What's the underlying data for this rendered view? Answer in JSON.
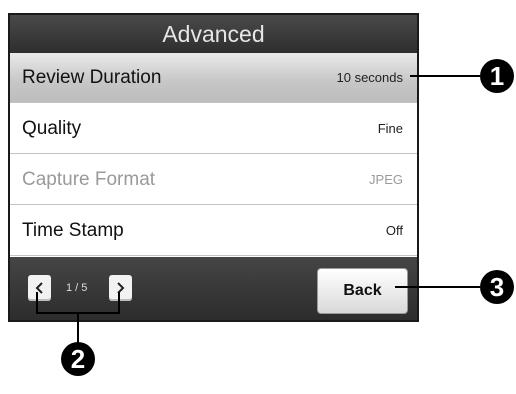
{
  "header": {
    "title": "Advanced"
  },
  "rows": [
    {
      "label": "Review Duration",
      "value": "10 seconds"
    },
    {
      "label": "Quality",
      "value": "Fine"
    },
    {
      "label": "Capture Format",
      "value": "JPEG"
    },
    {
      "label": "Time Stamp",
      "value": "Off"
    }
  ],
  "footer": {
    "page_indicator": "1 / 5",
    "back_label": "Back"
  },
  "callouts": [
    "1",
    "2",
    "3"
  ],
  "icons": {
    "prev": "chevron-left-icon",
    "next": "chevron-right-icon"
  }
}
